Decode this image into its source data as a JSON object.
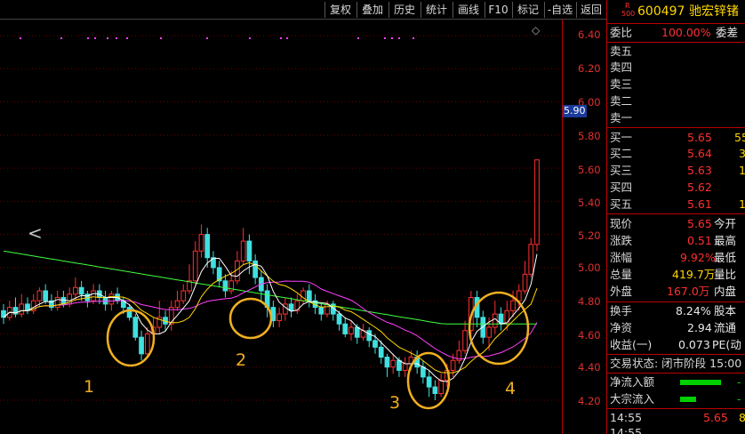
{
  "toolbar": {
    "buttons": [
      "复权",
      "叠加",
      "历史",
      "统计",
      "画线",
      "F10",
      "标记",
      "-自选",
      "返回"
    ]
  },
  "stock": {
    "badge_top": "R",
    "badge_bottom": "500",
    "code": "600497",
    "name": "驰宏锌锗"
  },
  "price_axis": {
    "ticks": [
      "6.40",
      "6.20",
      "6.00",
      "5.80",
      "5.60",
      "5.40",
      "5.20",
      "5.00",
      "4.80",
      "4.60",
      "4.40",
      "4.20"
    ],
    "cursor_price": "5.90"
  },
  "chart_labels": [
    "1",
    "2",
    "3",
    "4"
  ],
  "back_arrow": "<",
  "colors": {
    "up": "#ff3030",
    "down": "#40e0e0",
    "ma5": "#ffffff",
    "ma10": "#ffd700",
    "ma20": "#ff40ff",
    "ma60": "#40ff40",
    "circle": "#f0b020"
  },
  "order_book": {
    "ratio_label": "委比",
    "ratio_value": "100.00%",
    "diff_label": "委差",
    "sells": [
      {
        "label": "卖五",
        "price": "",
        "vol": ""
      },
      {
        "label": "卖四",
        "price": "",
        "vol": ""
      },
      {
        "label": "卖三",
        "price": "",
        "vol": ""
      },
      {
        "label": "卖二",
        "price": "",
        "vol": ""
      },
      {
        "label": "卖一",
        "price": "",
        "vol": ""
      }
    ],
    "buys": [
      {
        "label": "买一",
        "price": "5.65",
        "vol": "55"
      },
      {
        "label": "买二",
        "price": "5.64",
        "vol": "3"
      },
      {
        "label": "买三",
        "price": "5.63",
        "vol": "1"
      },
      {
        "label": "买四",
        "price": "5.62",
        "vol": ""
      },
      {
        "label": "买五",
        "price": "5.61",
        "vol": "1"
      }
    ]
  },
  "quote": [
    {
      "l1": "现价",
      "v1": "5.65",
      "l2": "今开",
      "c": "red"
    },
    {
      "l1": "涨跌",
      "v1": "0.51",
      "l2": "最高",
      "c": "red"
    },
    {
      "l1": "涨幅",
      "v1": "9.92%",
      "l2": "最低",
      "c": "red"
    },
    {
      "l1": "总量",
      "v1": "419.7万",
      "l2": "量比",
      "c": "yel"
    },
    {
      "l1": "外盘",
      "v1": "167.0万",
      "l2": "内盘",
      "c": "red"
    }
  ],
  "stats": [
    {
      "l1": "换手",
      "v1": "8.24%",
      "l2": "股本"
    },
    {
      "l1": "净资",
      "v1": "2.94",
      "l2": "流通"
    },
    {
      "l1": "收益(一)",
      "v1": "0.073",
      "l2": "PE(动"
    }
  ],
  "trade_status": "交易状态: 闭市阶段 15:00",
  "flows": [
    {
      "label": "净流入额",
      "value": "-"
    },
    {
      "label": "大宗流入",
      "value": "-"
    }
  ],
  "ticks_list": [
    {
      "time": "14:55",
      "price": "5.65",
      "vol": "8"
    },
    {
      "time": "14:55",
      "price": "",
      "vol": ""
    }
  ],
  "chart_data": {
    "type": "candlestick",
    "ylim": [
      4.15,
      6.45
    ],
    "candles": [
      [
        4.74,
        4.7,
        4.78,
        4.66
      ],
      [
        4.7,
        4.76,
        4.8,
        4.68
      ],
      [
        4.76,
        4.72,
        4.82,
        4.7
      ],
      [
        4.72,
        4.78,
        4.84,
        4.7
      ],
      [
        4.78,
        4.74,
        4.82,
        4.72
      ],
      [
        4.74,
        4.8,
        4.84,
        4.72
      ],
      [
        4.8,
        4.86,
        4.88,
        4.76
      ],
      [
        4.86,
        4.8,
        4.9,
        4.78
      ],
      [
        4.8,
        4.76,
        4.84,
        4.74
      ],
      [
        4.76,
        4.82,
        4.86,
        4.74
      ],
      [
        4.82,
        4.78,
        4.86,
        4.76
      ],
      [
        4.78,
        4.84,
        4.88,
        4.76
      ],
      [
        4.84,
        4.88,
        4.94,
        4.8
      ],
      [
        4.88,
        4.84,
        4.92,
        4.8
      ],
      [
        4.84,
        4.8,
        4.86,
        4.76
      ],
      [
        4.8,
        4.86,
        4.9,
        4.78
      ],
      [
        4.86,
        4.82,
        4.9,
        4.78
      ],
      [
        4.82,
        4.78,
        4.86,
        4.74
      ],
      [
        4.78,
        4.84,
        4.86,
        4.74
      ],
      [
        4.84,
        4.8,
        4.88,
        4.78
      ],
      [
        4.8,
        4.76,
        4.82,
        4.72
      ],
      [
        4.76,
        4.7,
        4.78,
        4.68
      ],
      [
        4.7,
        4.58,
        4.72,
        4.56
      ],
      [
        4.58,
        4.48,
        4.62,
        4.44
      ],
      [
        4.48,
        4.6,
        4.64,
        4.46
      ],
      [
        4.6,
        4.64,
        4.7,
        4.56
      ],
      [
        4.64,
        4.7,
        4.8,
        4.6
      ],
      [
        4.7,
        4.66,
        4.74,
        4.62
      ],
      [
        4.66,
        4.76,
        4.8,
        4.62
      ],
      [
        4.76,
        4.8,
        4.86,
        4.74
      ],
      [
        4.8,
        4.86,
        4.9,
        4.78
      ],
      [
        4.86,
        4.92,
        5.02,
        4.84
      ],
      [
        4.92,
        5.1,
        5.16,
        4.9
      ],
      [
        5.1,
        5.2,
        5.26,
        5.06
      ],
      [
        5.2,
        5.06,
        5.24,
        5.0
      ],
      [
        5.06,
        5.0,
        5.1,
        4.96
      ],
      [
        5.0,
        4.92,
        5.04,
        4.88
      ],
      [
        4.92,
        4.86,
        4.96,
        4.82
      ],
      [
        4.86,
        4.92,
        4.98,
        4.84
      ],
      [
        4.92,
        5.04,
        5.1,
        4.9
      ],
      [
        5.04,
        5.16,
        5.24,
        5.02
      ],
      [
        5.16,
        5.04,
        5.2,
        4.96
      ],
      [
        5.04,
        4.94,
        5.08,
        4.9
      ],
      [
        4.94,
        4.86,
        4.98,
        4.8
      ],
      [
        4.86,
        4.76,
        4.9,
        4.7
      ],
      [
        4.76,
        4.68,
        4.8,
        4.64
      ],
      [
        4.68,
        4.72,
        4.76,
        4.64
      ],
      [
        4.72,
        4.78,
        4.82,
        4.68
      ],
      [
        4.78,
        4.74,
        4.82,
        4.7
      ],
      [
        4.74,
        4.8,
        4.84,
        4.72
      ],
      [
        4.8,
        4.86,
        4.88,
        4.78
      ],
      [
        4.86,
        4.8,
        4.9,
        4.76
      ],
      [
        4.8,
        4.76,
        4.84,
        4.72
      ],
      [
        4.76,
        4.72,
        4.78,
        4.68
      ],
      [
        4.72,
        4.78,
        4.8,
        4.7
      ],
      [
        4.78,
        4.72,
        4.8,
        4.68
      ],
      [
        4.72,
        4.66,
        4.74,
        4.62
      ],
      [
        4.66,
        4.6,
        4.7,
        4.58
      ],
      [
        4.6,
        4.64,
        4.68,
        4.56
      ],
      [
        4.64,
        4.58,
        4.66,
        4.54
      ],
      [
        4.58,
        4.62,
        4.66,
        4.56
      ],
      [
        4.62,
        4.56,
        4.64,
        4.52
      ],
      [
        4.56,
        4.52,
        4.6,
        4.48
      ],
      [
        4.52,
        4.46,
        4.56,
        4.42
      ],
      [
        4.46,
        4.4,
        4.48,
        4.34
      ],
      [
        4.4,
        4.44,
        4.48,
        4.36
      ],
      [
        4.44,
        4.38,
        4.46,
        4.34
      ],
      [
        4.38,
        4.42,
        4.46,
        4.34
      ],
      [
        4.42,
        4.46,
        4.5,
        4.38
      ],
      [
        4.46,
        4.4,
        4.5,
        4.36
      ],
      [
        4.4,
        4.34,
        4.44,
        4.3
      ],
      [
        4.34,
        4.28,
        4.38,
        4.22
      ],
      [
        4.28,
        4.24,
        4.32,
        4.2
      ],
      [
        4.24,
        4.32,
        4.36,
        4.22
      ],
      [
        4.32,
        4.38,
        4.42,
        4.28
      ],
      [
        4.38,
        4.44,
        4.48,
        4.34
      ],
      [
        4.44,
        4.5,
        4.56,
        4.42
      ],
      [
        4.5,
        4.62,
        4.68,
        4.48
      ],
      [
        4.62,
        4.82,
        4.86,
        4.58
      ],
      [
        4.82,
        4.7,
        4.86,
        4.64
      ],
      [
        4.7,
        4.58,
        4.74,
        4.54
      ],
      [
        4.58,
        4.64,
        4.7,
        4.5
      ],
      [
        4.64,
        4.72,
        4.8,
        4.6
      ],
      [
        4.72,
        4.66,
        4.76,
        4.62
      ],
      [
        4.66,
        4.74,
        4.8,
        4.62
      ],
      [
        4.74,
        4.8,
        4.86,
        4.7
      ],
      [
        4.8,
        4.86,
        4.9,
        4.74
      ],
      [
        4.86,
        4.96,
        5.04,
        4.84
      ],
      [
        4.96,
        5.14,
        5.18,
        4.94
      ],
      [
        5.14,
        5.65,
        5.65,
        5.1
      ]
    ]
  }
}
